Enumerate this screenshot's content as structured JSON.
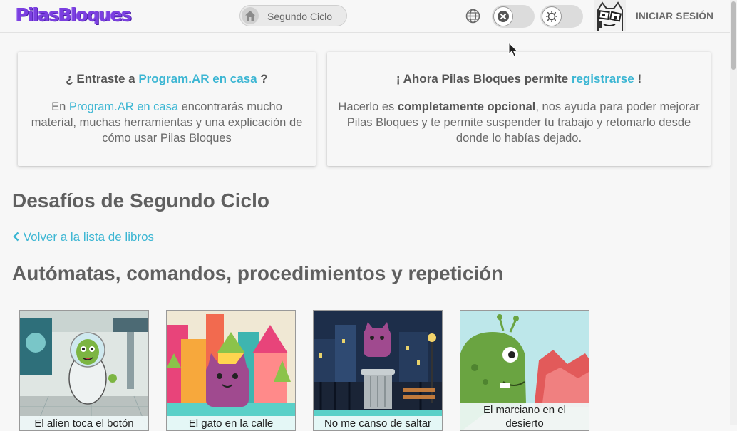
{
  "header": {
    "logo": "PilasBloques",
    "breadcrumb": "Segundo Ciclo",
    "login": "INICIAR SESIÓN",
    "icons": [
      "home-icon",
      "globe-icon",
      "close-icon",
      "sun-icon"
    ]
  },
  "cards": [
    {
      "title_pre": "¿ Entraste a ",
      "title_link": "Program.AR en casa",
      "title_post": " ?",
      "body_pre": "En ",
      "body_link": "Program.AR en casa",
      "body_post": " encontrarás mucho material, muchas herramientas y una explicación de cómo usar Pilas Bloques"
    },
    {
      "title_pre": "¡ Ahora Pilas Bloques permite ",
      "title_link": "registrarse",
      "title_post": " !",
      "body_pre": "Hacerlo es ",
      "body_strong": "completamente opcional",
      "body_post": ", nos ayuda para poder mejorar Pilas Bloques y te permite suspender tu trabajo y retomarlo desde donde lo habías dejado."
    }
  ],
  "page_title": "Desafíos de Segundo Ciclo",
  "back_link": "Volver a la lista de libros",
  "section_title": "Autómatas, comandos, procedimientos y repetición",
  "challenges": [
    {
      "title": "El alien toca el botón"
    },
    {
      "title": "El gato en la calle"
    },
    {
      "title": "No me canso de saltar"
    },
    {
      "title": "El marciano en el desierto"
    }
  ],
  "colors": {
    "accent": "#3cb6d3",
    "logo": "#7b3fe0",
    "background": "#f7f7f7"
  }
}
